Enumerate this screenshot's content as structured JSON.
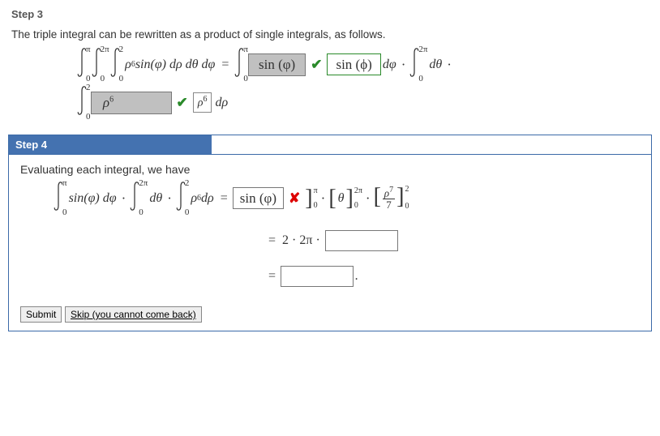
{
  "step3": {
    "title": "Step 3",
    "intro": "The triple integral can be rewritten as a product of single integrals, as follows.",
    "lhs": {
      "b1u": "π",
      "b1l": "0",
      "b2u": "2π",
      "b2l": "0",
      "b3u": "2",
      "b3l": "0",
      "integrand": "ρ",
      "exp": "6",
      "rest": " sin(φ) dρ dθ dφ"
    },
    "rhs1": {
      "bu": "π",
      "bl": "0",
      "box": "sin (φ)"
    },
    "rhs2": {
      "box": "sin (ϕ)",
      "after": "dφ"
    },
    "rhs3": {
      "bu": "2π",
      "bl": "0",
      "after": "dθ"
    },
    "line2": {
      "bu": "2",
      "bl": "0",
      "box1_rho": "ρ",
      "box1_exp": "6",
      "small_rho": "ρ",
      "small_exp": "6",
      "small_after": "dρ"
    }
  },
  "step4": {
    "title": "Step 4",
    "intro": "Evaluating each integral, we have",
    "lhs": {
      "b1u": "π",
      "b1l": "0",
      "i1": "sin(φ) dφ",
      "b2u": "2π",
      "b2l": "0",
      "i2": "dθ",
      "b3u": "2",
      "b3l": "0",
      "i3_rho": "ρ",
      "i3_exp": "6",
      "i3_rest": " dρ"
    },
    "box": "sin (φ)",
    "eval1": {
      "mid": "",
      "u": "π",
      "l": "0"
    },
    "eval2": {
      "mid": "θ",
      "u": "2π",
      "l": "0"
    },
    "eval3": {
      "num_rho": "ρ",
      "num_exp": "7",
      "den": "7",
      "u": "2",
      "l": "0"
    },
    "line2": "2 · 2π ·",
    "line3_eq": "="
  },
  "buttons": {
    "submit": "Submit",
    "skip": "Skip (you cannot come back)"
  }
}
